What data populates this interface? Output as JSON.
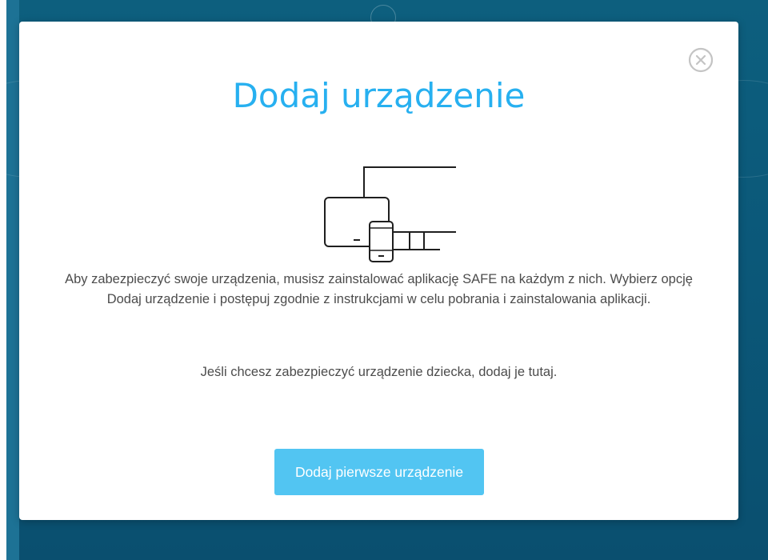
{
  "modal": {
    "title": "Dodaj urządzenie",
    "description": "Aby zabezpieczyć swoje urządzenia, musisz zainstalować aplikację SAFE na każdym z nich. Wybierz opcję Dodaj urządzenie i postępuj zgodnie z instrukcjami w celu pobrania i zainstalowania aplikacji.",
    "child_note": "Jeśli chcesz zabezpieczyć urządzenie dziecka, dodaj je tutaj.",
    "primary_button_label": "Dodaj pierwsze urządzenie",
    "close_icon": "close-circle-icon",
    "illustration_icon": "devices-icon"
  },
  "colors": {
    "title": "#27b0f0",
    "button_background": "#52c5f2",
    "button_text": "#ffffff",
    "body_text": "#4c4c4c",
    "backdrop": "#0b5879",
    "close_icon": "#c4c4c4"
  }
}
